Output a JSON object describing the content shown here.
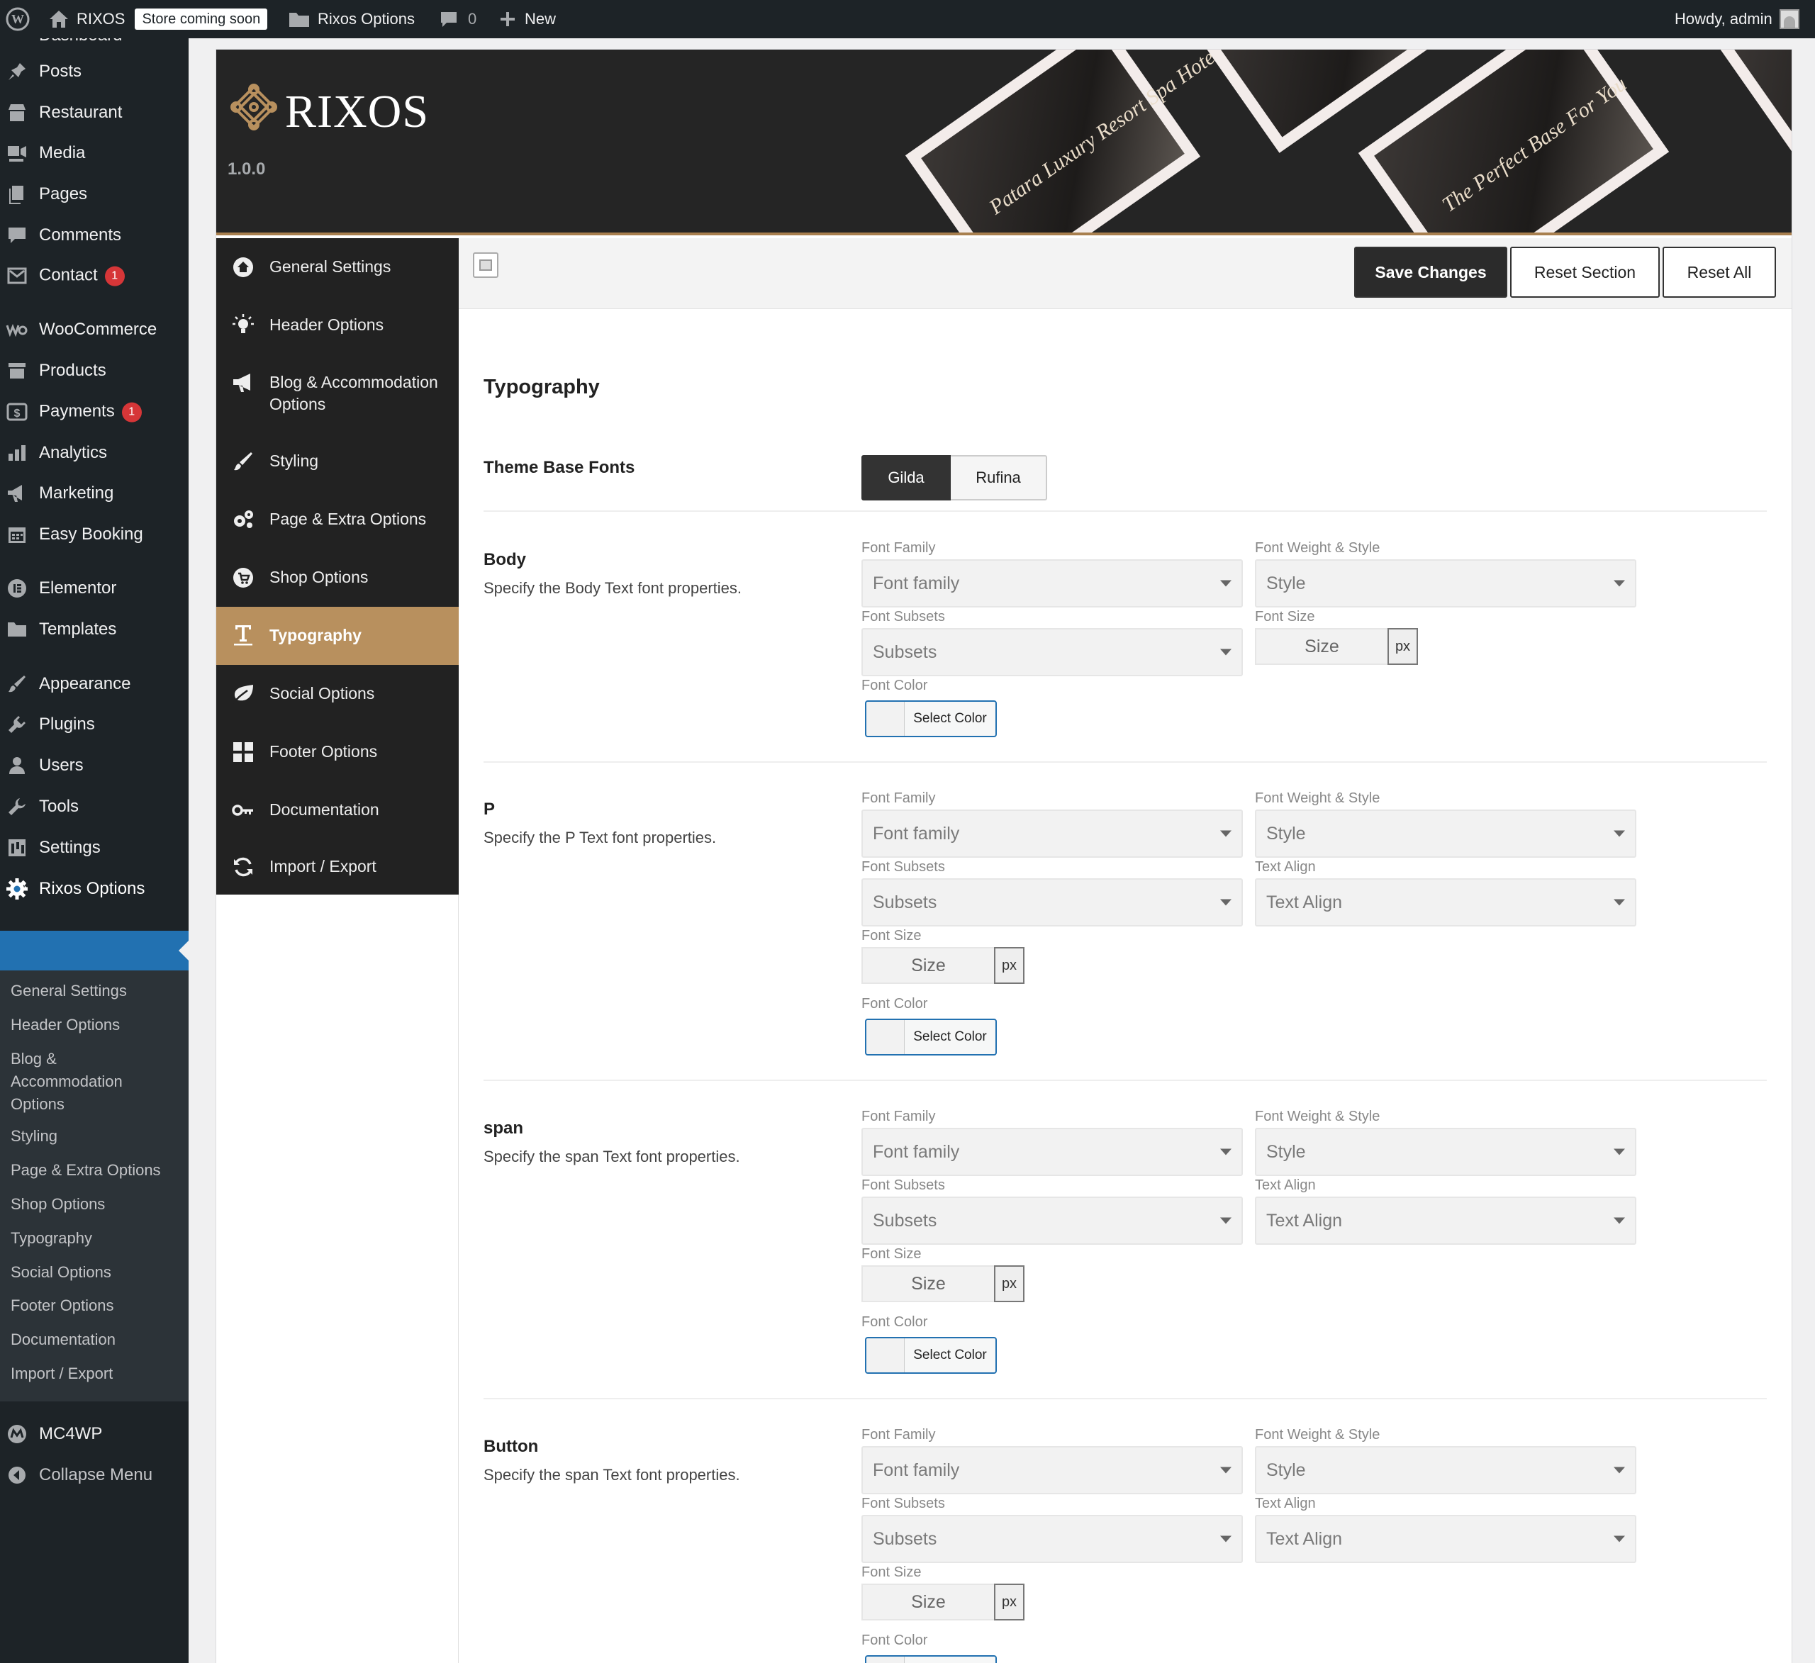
{
  "admin_bar": {
    "site_name": "RIXOS",
    "store_badge": "Store coming soon",
    "options_link": "Rixos Options",
    "comments_count": "0",
    "new_label": "New",
    "greeting": "Howdy, admin"
  },
  "admin_menu": {
    "items": [
      {
        "label": "Dashboard",
        "icon": "dashboard-icon"
      },
      {
        "label": "Posts",
        "icon": "pin-icon"
      },
      {
        "label": "Restaurant",
        "icon": "store-icon"
      },
      {
        "label": "Media",
        "icon": "media-icon"
      },
      {
        "label": "Pages",
        "icon": "pages-icon"
      },
      {
        "label": "Comments",
        "icon": "comment-icon"
      },
      {
        "label": "Contact",
        "icon": "mail-icon",
        "badge": "1"
      },
      {
        "label": "WooCommerce",
        "icon": "woo-icon"
      },
      {
        "label": "Products",
        "icon": "archive-icon"
      },
      {
        "label": "Payments",
        "icon": "dollar-icon",
        "badge": "1"
      },
      {
        "label": "Analytics",
        "icon": "bar-chart-icon"
      },
      {
        "label": "Marketing",
        "icon": "megaphone-icon"
      },
      {
        "label": "Easy Booking",
        "icon": "calendar-icon"
      },
      {
        "label": "Elementor",
        "icon": "elementor-icon"
      },
      {
        "label": "Templates",
        "icon": "folder-icon"
      },
      {
        "label": "Appearance",
        "icon": "brush-icon"
      },
      {
        "label": "Plugins",
        "icon": "plug-icon"
      },
      {
        "label": "Users",
        "icon": "user-icon"
      },
      {
        "label": "Tools",
        "icon": "wrench-icon"
      },
      {
        "label": "Settings",
        "icon": "settings-sliders-icon"
      },
      {
        "label": "Rixos Options",
        "icon": "gear-icon"
      },
      {
        "label": "MC4WP",
        "icon": "mc4wp-icon"
      },
      {
        "label": "Collapse Menu",
        "icon": "collapse-icon"
      }
    ],
    "submenu": [
      "General Settings",
      "Header Options",
      "Blog & Accommodation Options",
      "Styling",
      "Page & Extra Options",
      "Shop Options",
      "Typography",
      "Social Options",
      "Footer Options",
      "Documentation",
      "Import / Export"
    ]
  },
  "banner": {
    "brand": "RIXOS",
    "version": "1.0.0",
    "screens": [
      "Patara Luxury Resort Spa Hotel",
      "The Perfect Base For You"
    ]
  },
  "side_nav": [
    {
      "label": "General Settings",
      "icon": "home-icon"
    },
    {
      "label": "Header Options",
      "icon": "lightbulb-icon"
    },
    {
      "label": "Blog & Accommodation Options",
      "icon": "bullhorn-icon"
    },
    {
      "label": "Styling",
      "icon": "brush-icon"
    },
    {
      "label": "Page & Extra Options",
      "icon": "cogs-icon"
    },
    {
      "label": "Shop Options",
      "icon": "cart-icon"
    },
    {
      "label": "Typography",
      "icon": "text-icon"
    },
    {
      "label": "Social Options",
      "icon": "leaf-icon"
    },
    {
      "label": "Footer Options",
      "icon": "grid-icon"
    },
    {
      "label": "Documentation",
      "icon": "key-icon"
    },
    {
      "label": "Import / Export",
      "icon": "refresh-icon"
    }
  ],
  "toolbar": {
    "save": "Save Changes",
    "reset_section": "Reset Section",
    "reset_all": "Reset All"
  },
  "section_title": "Typography",
  "base_fonts": {
    "label": "Theme Base Fonts",
    "options": [
      "Gilda",
      "Rufina"
    ],
    "selected": "Gilda"
  },
  "field_labels": {
    "font_family": "Font Family",
    "font_weight": "Font Weight & Style",
    "font_subsets": "Font Subsets",
    "font_size": "Font Size",
    "text_align": "Text Align",
    "font_color": "Font Color"
  },
  "placeholders": {
    "family": "Font family",
    "style": "Style",
    "subsets": "Subsets",
    "size": "Size",
    "unit": "px",
    "align": "Text Align",
    "color": "Select Color"
  },
  "rows": [
    {
      "title": "Body",
      "desc": "Specify the Body Text font properties."
    },
    {
      "title": "P",
      "desc": "Specify the P Text font properties."
    },
    {
      "title": "span",
      "desc": "Specify the span Text font properties."
    },
    {
      "title": "Button",
      "desc": "Specify the span Text font properties."
    }
  ]
}
